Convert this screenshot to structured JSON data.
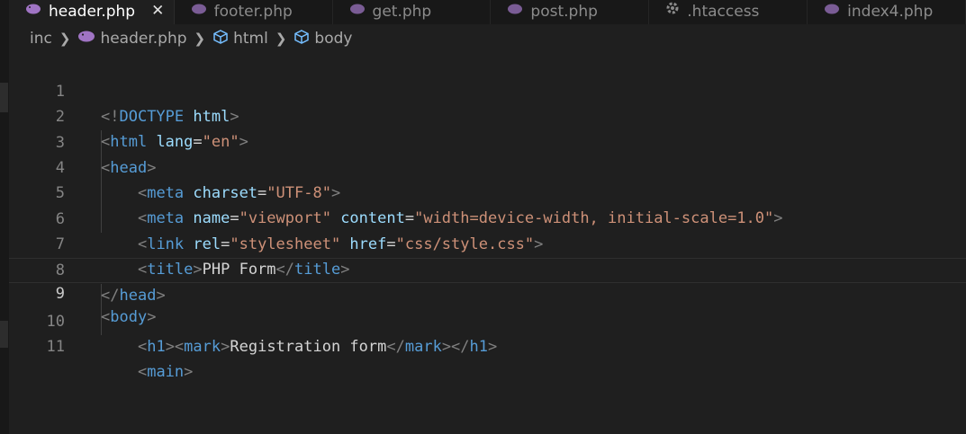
{
  "tabs": [
    {
      "label": "header.php",
      "icon": "php-elephant-icon",
      "active": true,
      "closeGlyph": "✕"
    },
    {
      "label": "footer.php",
      "icon": "php-elephant-icon",
      "active": false
    },
    {
      "label": "get.php",
      "icon": "php-elephant-icon",
      "active": false
    },
    {
      "label": "post.php",
      "icon": "php-elephant-icon",
      "active": false
    },
    {
      "label": ".htaccess",
      "icon": "gear-icon",
      "active": false
    },
    {
      "label": "index4.php",
      "icon": "php-elephant-icon",
      "active": false
    }
  ],
  "breadcrumb": {
    "folder": "inc",
    "file": "header.php",
    "symbols": [
      "html",
      "body"
    ]
  },
  "editor": {
    "current_line": 9,
    "lines": [
      {
        "n": "1"
      },
      {
        "n": "2"
      },
      {
        "n": "3"
      },
      {
        "n": "4"
      },
      {
        "n": "5"
      },
      {
        "n": "6"
      },
      {
        "n": "7"
      },
      {
        "n": "8"
      },
      {
        "n": "9"
      },
      {
        "n": "10"
      },
      {
        "n": "11"
      }
    ],
    "tokens": {
      "l1": [
        "<!",
        "DOCTYPE",
        " html",
        ">"
      ],
      "l2": [
        "<",
        "html",
        " lang",
        "=",
        "\"en\"",
        ">"
      ],
      "l3": [
        "<",
        "head",
        ">"
      ],
      "l4": [
        "<",
        "meta",
        " charset",
        "=",
        "\"UTF-8\"",
        ">"
      ],
      "l5": [
        "<",
        "meta",
        " name",
        "=",
        "\"viewport\"",
        " content",
        "=",
        "\"width=device-width, initial-scale=1.0\"",
        ">"
      ],
      "l6": [
        "<",
        "link",
        " rel",
        "=",
        "\"stylesheet\"",
        " href",
        "=",
        "\"css/style.css\"",
        ">"
      ],
      "l7": [
        "<",
        "title",
        ">",
        "PHP Form",
        "</",
        "title",
        ">"
      ],
      "l8": [
        "</",
        "head",
        ">"
      ],
      "l9": [
        "<",
        "body",
        ">"
      ],
      "l10": [
        "<",
        "h1",
        "><",
        "mark",
        ">",
        "Registration form",
        "</",
        "mark",
        "></",
        "h1",
        ">"
      ],
      "l11": [
        "<",
        "main",
        ">"
      ]
    }
  },
  "colors": {
    "background": "#1f1f1f",
    "tag": "#569cd6",
    "attribute": "#9cdcfe",
    "string": "#ce9178",
    "punctuation": "#808080",
    "php_icon": "#a074c4"
  }
}
